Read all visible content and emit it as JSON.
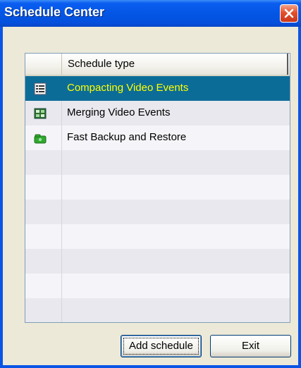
{
  "window": {
    "title": "Schedule Center"
  },
  "list": {
    "column_header": "Schedule type",
    "rows": [
      {
        "label": "Compacting Video Events",
        "icon": "compact-events-icon",
        "selected": true
      },
      {
        "label": "Merging Video Events",
        "icon": "merge-events-icon",
        "selected": false
      },
      {
        "label": "Fast Backup and Restore",
        "icon": "backup-restore-icon",
        "selected": false
      }
    ],
    "empty_rows": 6
  },
  "buttons": {
    "add_schedule": "Add schedule",
    "exit": "Exit"
  },
  "colors": {
    "titlebar": "#0456e5",
    "selection": "#0c6c98",
    "selection_text": "#ffff00",
    "window_bg": "#ece9d8"
  }
}
